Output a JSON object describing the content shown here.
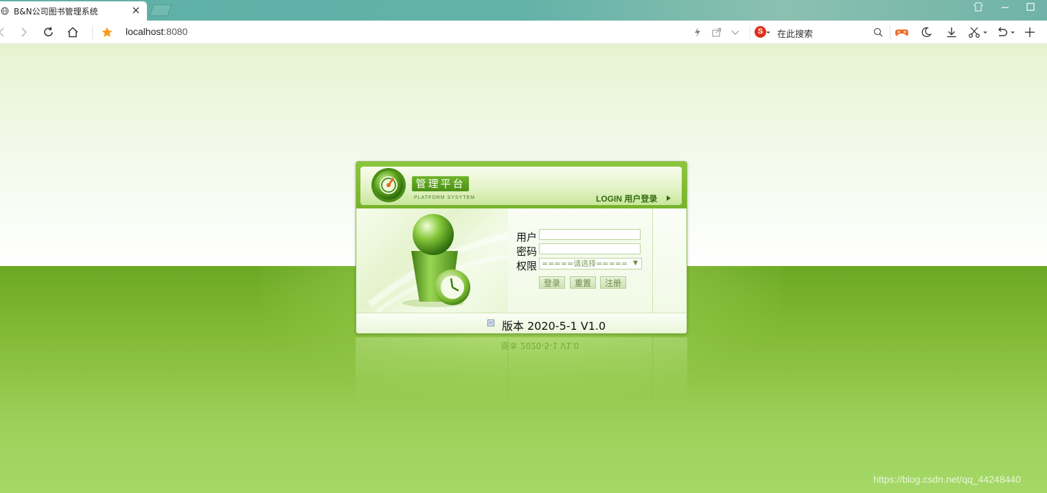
{
  "browser": {
    "tab_title": "B&N公司图书管理系统",
    "address_host": "localhost",
    "address_port": ":8080",
    "search_placeholder": "在此搜索",
    "search_engine_logo": "S"
  },
  "login_panel": {
    "brand_title": "管理平台",
    "brand_subtitle": "PLATFORM SYSYTEM",
    "header_label": "LOGIN 用户登录",
    "fields": {
      "user_label": "用户",
      "password_label": "密码",
      "role_label": "权限",
      "role_selected": "=====请选择====="
    },
    "buttons": {
      "login": "登录",
      "reset": "重置",
      "register": "注册"
    },
    "version": "版本 2020-5-1 V1.0"
  },
  "reflection": {
    "version_text": "版本 2020-5-1 V1.0"
  },
  "watermark": "https://blog.csdn.net/qq_44248440",
  "colors": {
    "accent_green": "#78b32c",
    "page_bottom": "#6ca824",
    "tabbar": "#5fb0a7"
  }
}
